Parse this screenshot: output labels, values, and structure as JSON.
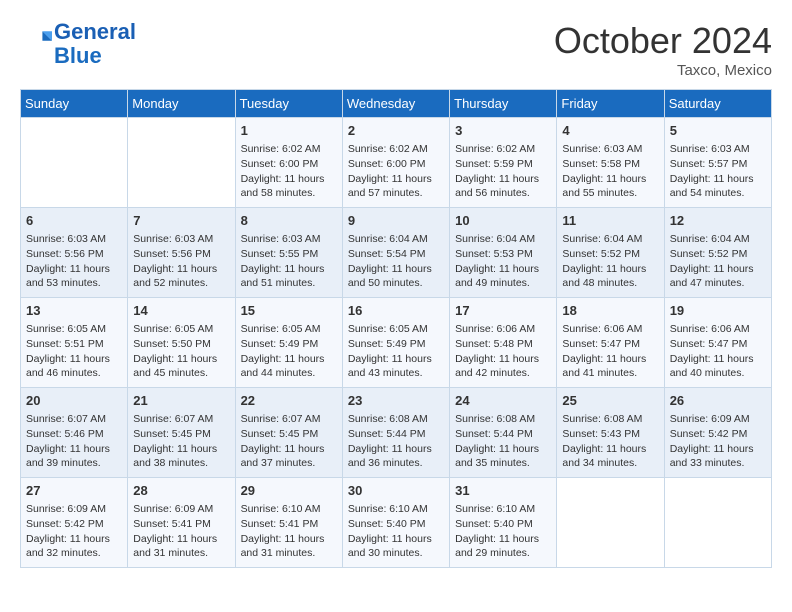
{
  "header": {
    "logo_line1": "General",
    "logo_line2": "Blue",
    "month": "October 2024",
    "location": "Taxco, Mexico"
  },
  "weekdays": [
    "Sunday",
    "Monday",
    "Tuesday",
    "Wednesday",
    "Thursday",
    "Friday",
    "Saturday"
  ],
  "weeks": [
    [
      {
        "day": "",
        "info": ""
      },
      {
        "day": "",
        "info": ""
      },
      {
        "day": "1",
        "info": "Sunrise: 6:02 AM\nSunset: 6:00 PM\nDaylight: 11 hours and 58 minutes."
      },
      {
        "day": "2",
        "info": "Sunrise: 6:02 AM\nSunset: 6:00 PM\nDaylight: 11 hours and 57 minutes."
      },
      {
        "day": "3",
        "info": "Sunrise: 6:02 AM\nSunset: 5:59 PM\nDaylight: 11 hours and 56 minutes."
      },
      {
        "day": "4",
        "info": "Sunrise: 6:03 AM\nSunset: 5:58 PM\nDaylight: 11 hours and 55 minutes."
      },
      {
        "day": "5",
        "info": "Sunrise: 6:03 AM\nSunset: 5:57 PM\nDaylight: 11 hours and 54 minutes."
      }
    ],
    [
      {
        "day": "6",
        "info": "Sunrise: 6:03 AM\nSunset: 5:56 PM\nDaylight: 11 hours and 53 minutes."
      },
      {
        "day": "7",
        "info": "Sunrise: 6:03 AM\nSunset: 5:56 PM\nDaylight: 11 hours and 52 minutes."
      },
      {
        "day": "8",
        "info": "Sunrise: 6:03 AM\nSunset: 5:55 PM\nDaylight: 11 hours and 51 minutes."
      },
      {
        "day": "9",
        "info": "Sunrise: 6:04 AM\nSunset: 5:54 PM\nDaylight: 11 hours and 50 minutes."
      },
      {
        "day": "10",
        "info": "Sunrise: 6:04 AM\nSunset: 5:53 PM\nDaylight: 11 hours and 49 minutes."
      },
      {
        "day": "11",
        "info": "Sunrise: 6:04 AM\nSunset: 5:52 PM\nDaylight: 11 hours and 48 minutes."
      },
      {
        "day": "12",
        "info": "Sunrise: 6:04 AM\nSunset: 5:52 PM\nDaylight: 11 hours and 47 minutes."
      }
    ],
    [
      {
        "day": "13",
        "info": "Sunrise: 6:05 AM\nSunset: 5:51 PM\nDaylight: 11 hours and 46 minutes."
      },
      {
        "day": "14",
        "info": "Sunrise: 6:05 AM\nSunset: 5:50 PM\nDaylight: 11 hours and 45 minutes."
      },
      {
        "day": "15",
        "info": "Sunrise: 6:05 AM\nSunset: 5:49 PM\nDaylight: 11 hours and 44 minutes."
      },
      {
        "day": "16",
        "info": "Sunrise: 6:05 AM\nSunset: 5:49 PM\nDaylight: 11 hours and 43 minutes."
      },
      {
        "day": "17",
        "info": "Sunrise: 6:06 AM\nSunset: 5:48 PM\nDaylight: 11 hours and 42 minutes."
      },
      {
        "day": "18",
        "info": "Sunrise: 6:06 AM\nSunset: 5:47 PM\nDaylight: 11 hours and 41 minutes."
      },
      {
        "day": "19",
        "info": "Sunrise: 6:06 AM\nSunset: 5:47 PM\nDaylight: 11 hours and 40 minutes."
      }
    ],
    [
      {
        "day": "20",
        "info": "Sunrise: 6:07 AM\nSunset: 5:46 PM\nDaylight: 11 hours and 39 minutes."
      },
      {
        "day": "21",
        "info": "Sunrise: 6:07 AM\nSunset: 5:45 PM\nDaylight: 11 hours and 38 minutes."
      },
      {
        "day": "22",
        "info": "Sunrise: 6:07 AM\nSunset: 5:45 PM\nDaylight: 11 hours and 37 minutes."
      },
      {
        "day": "23",
        "info": "Sunrise: 6:08 AM\nSunset: 5:44 PM\nDaylight: 11 hours and 36 minutes."
      },
      {
        "day": "24",
        "info": "Sunrise: 6:08 AM\nSunset: 5:44 PM\nDaylight: 11 hours and 35 minutes."
      },
      {
        "day": "25",
        "info": "Sunrise: 6:08 AM\nSunset: 5:43 PM\nDaylight: 11 hours and 34 minutes."
      },
      {
        "day": "26",
        "info": "Sunrise: 6:09 AM\nSunset: 5:42 PM\nDaylight: 11 hours and 33 minutes."
      }
    ],
    [
      {
        "day": "27",
        "info": "Sunrise: 6:09 AM\nSunset: 5:42 PM\nDaylight: 11 hours and 32 minutes."
      },
      {
        "day": "28",
        "info": "Sunrise: 6:09 AM\nSunset: 5:41 PM\nDaylight: 11 hours and 31 minutes."
      },
      {
        "day": "29",
        "info": "Sunrise: 6:10 AM\nSunset: 5:41 PM\nDaylight: 11 hours and 31 minutes."
      },
      {
        "day": "30",
        "info": "Sunrise: 6:10 AM\nSunset: 5:40 PM\nDaylight: 11 hours and 30 minutes."
      },
      {
        "day": "31",
        "info": "Sunrise: 6:10 AM\nSunset: 5:40 PM\nDaylight: 11 hours and 29 minutes."
      },
      {
        "day": "",
        "info": ""
      },
      {
        "day": "",
        "info": ""
      }
    ]
  ]
}
